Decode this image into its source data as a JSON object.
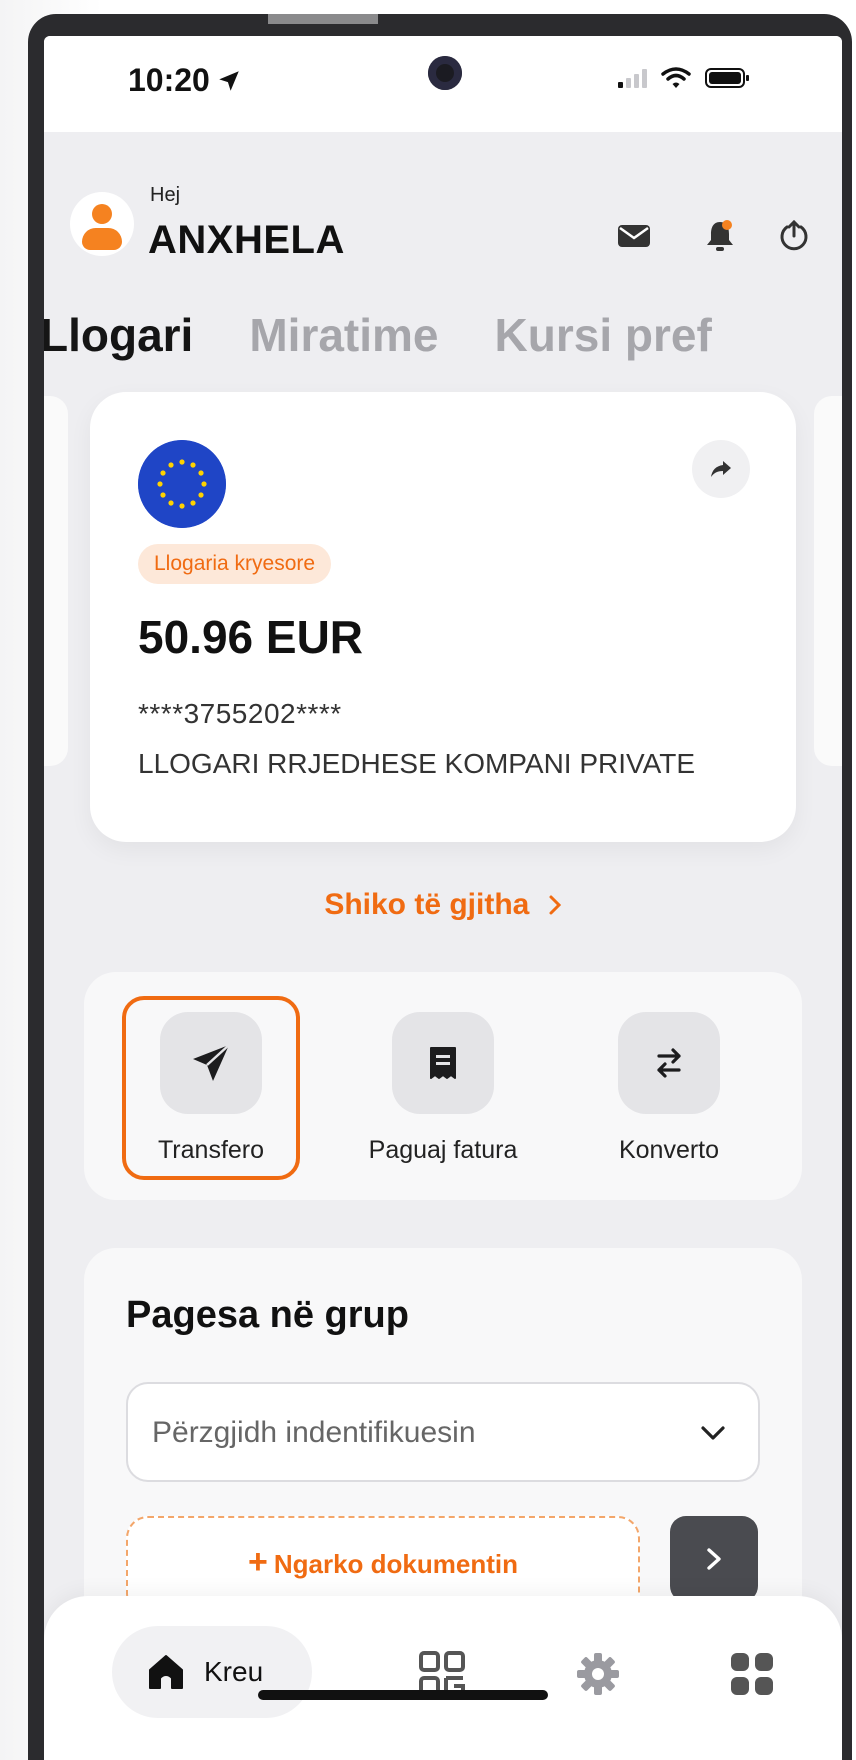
{
  "status_bar": {
    "time": "10:20",
    "icons": [
      "location-arrow-icon",
      "cellular-signal-icon",
      "wifi-icon",
      "battery-icon"
    ]
  },
  "header": {
    "greeting": "Hej",
    "user_name": "ANXHELA",
    "icons": [
      "mail-icon",
      "bell-icon",
      "power-icon"
    ],
    "notification_color": "#f58220"
  },
  "tabs": [
    {
      "label": "Llogari",
      "active": true
    },
    {
      "label": "Miratime",
      "active": false
    },
    {
      "label": "Kursi pref",
      "active": false
    }
  ],
  "account_card": {
    "badge": "Llogaria kryesore",
    "balance": "50.96 EUR",
    "account_number": "****3755202****",
    "account_type": "LLOGARI RRJEDHESE KOMPANI PRIVATE",
    "flag_icon": "eu-flag-icon",
    "share_icon": "share-icon"
  },
  "see_all": {
    "label": "Shiko të gjitha",
    "icon": "chevron-right-icon"
  },
  "quick_actions": [
    {
      "label": "Transfero",
      "icon": "send-icon",
      "selected": true
    },
    {
      "label": "Paguaj fatura",
      "icon": "receipt-icon",
      "selected": false
    },
    {
      "label": "Konverto",
      "icon": "exchange-icon",
      "selected": false
    }
  ],
  "group_payment": {
    "title": "Pagesa në grup",
    "select_placeholder": "Përzgjidh indentifikuesin",
    "upload_plus": "+",
    "upload_label": "Ngarko dokumentin"
  },
  "bottom_nav": {
    "home_label": "Kreu",
    "items": [
      "home-icon",
      "qr-code-icon",
      "gear-icon",
      "grid-icon"
    ]
  },
  "colors": {
    "accent": "#f06b12",
    "background": "#eeeef1",
    "card": "#ffffff"
  }
}
